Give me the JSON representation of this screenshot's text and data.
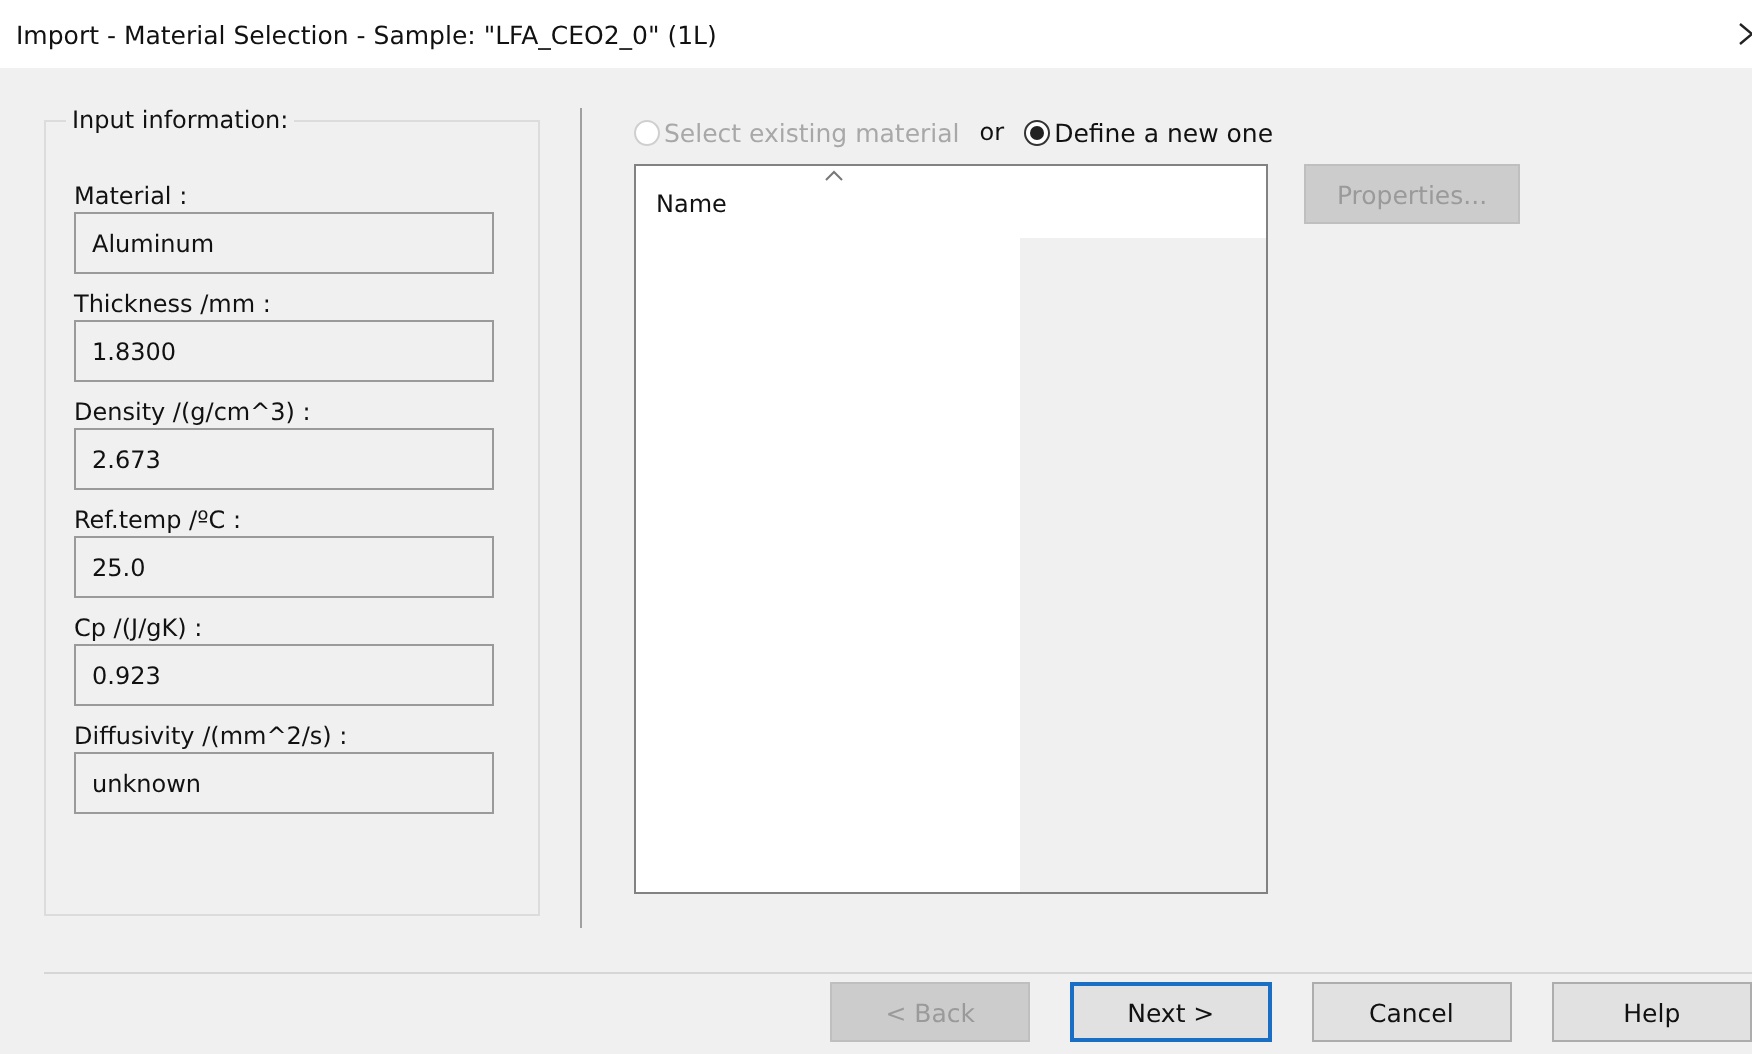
{
  "window": {
    "title": "Import - Material Selection - Sample: \"LFA_CEO2_0\" (1L)"
  },
  "input_group": {
    "title": "Input information:",
    "fields": [
      {
        "label": "Material :",
        "value": "Aluminum"
      },
      {
        "label": "Thickness /mm :",
        "value": "1.8300"
      },
      {
        "label": "Density /(g/cm^3) :",
        "value": "2.673"
      },
      {
        "label": "Ref.temp /ºC :",
        "value": "25.0"
      },
      {
        "label": "Cp /(J/gK) :",
        "value": "0.923"
      },
      {
        "label": "Diffusivity /(mm^2/s) :",
        "value": "unknown"
      }
    ]
  },
  "choice": {
    "options": [
      {
        "label": "Select existing material",
        "selected": false,
        "disabled": true
      },
      {
        "label": "Define a new one",
        "selected": true,
        "disabled": false
      }
    ],
    "separator": "or"
  },
  "list": {
    "columns": [
      "Name"
    ]
  },
  "properties_button": {
    "label": "Properties...",
    "disabled": true
  },
  "buttons": [
    {
      "label": "< Back",
      "disabled": true,
      "default": false
    },
    {
      "label": "Next >",
      "disabled": false,
      "default": true
    },
    {
      "label": "Cancel",
      "disabled": false,
      "default": false
    },
    {
      "label": "Help",
      "disabled": false,
      "default": false
    }
  ]
}
